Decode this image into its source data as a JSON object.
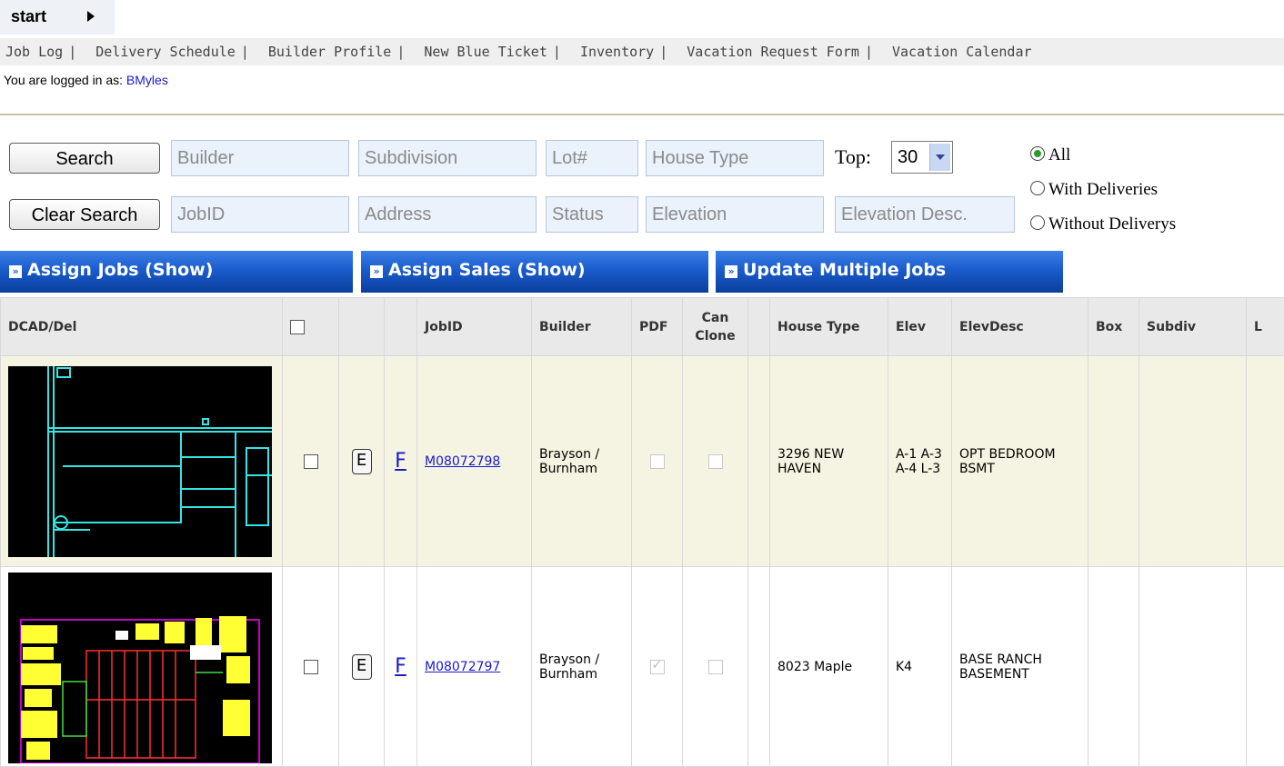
{
  "header": {
    "start_label": "start"
  },
  "nav": [
    "Job Log",
    "Delivery Schedule",
    "Builder Profile",
    "New Blue Ticket",
    "Inventory",
    "Vacation Request Form",
    "Vacation Calendar"
  ],
  "login": {
    "prefix": "You are logged in as:",
    "user": "BMyles"
  },
  "search": {
    "search_button": "Search",
    "clear_button": "Clear Search",
    "fields_row1": [
      "Builder",
      "Subdivision",
      "Lot#",
      "House Type"
    ],
    "fields_row2": [
      "JobID",
      "Address",
      "Status",
      "Elevation",
      "Elevation Desc."
    ],
    "top_label": "Top:",
    "top_value": "30",
    "radios": [
      {
        "label": "All",
        "checked": true
      },
      {
        "label": "With Deliveries",
        "checked": false
      },
      {
        "label": "Without Deliverys",
        "checked": false
      }
    ]
  },
  "panels": [
    "Assign Jobs (Show)",
    "Assign Sales (Show)",
    "Update Multiple Jobs"
  ],
  "table": {
    "headers": [
      "DCAD/Del",
      "",
      "",
      "",
      "JobID",
      "Builder",
      "PDF",
      "Can Clone",
      "",
      "House Type",
      "Elev",
      "ElevDesc",
      "Box",
      "Subdiv",
      "L"
    ],
    "rows": [
      {
        "e": "E",
        "f": "F",
        "jobid": "M08072798",
        "builder": "Brayson / Burnham",
        "pdf_checked": false,
        "clone_checked": false,
        "house_type": "3296 NEW HAVEN",
        "elev": "A-1 A-3 A-4 L-3",
        "elevdesc": "OPT BEDROOM BSMT"
      },
      {
        "e": "E",
        "f": "F",
        "jobid": "M08072797",
        "builder": "Brayson / Burnham",
        "pdf_checked": true,
        "clone_checked": false,
        "house_type": "8023 Maple",
        "elev": "K4",
        "elevdesc": "BASE RANCH BASEMENT"
      }
    ]
  },
  "colors": {
    "accent_blue": "#1a5ccc",
    "link": "#1a1acc",
    "cad_line": "#33e5e5"
  }
}
